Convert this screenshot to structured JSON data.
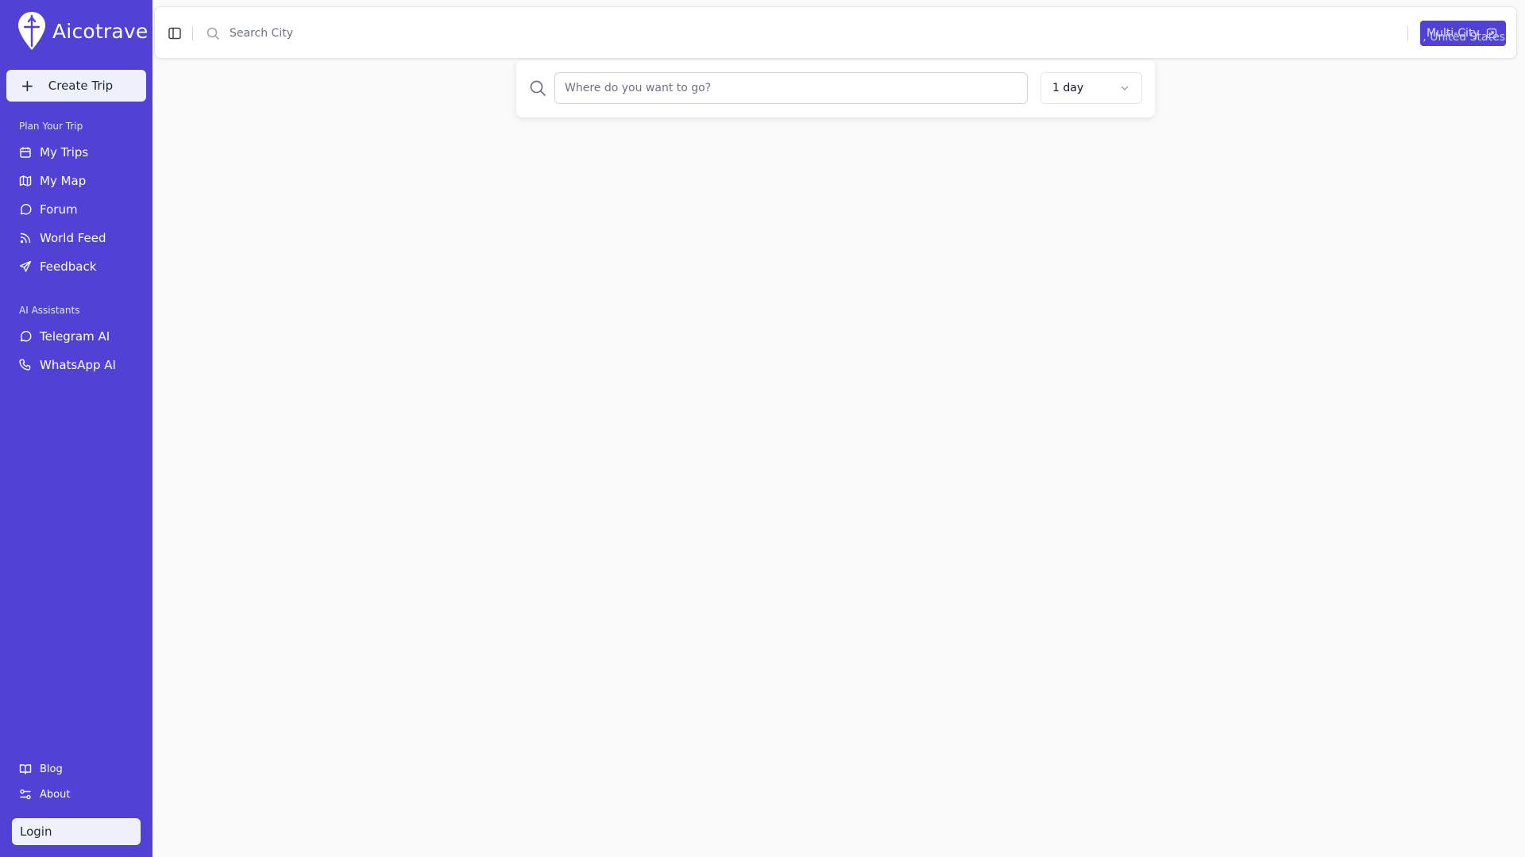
{
  "brand": {
    "name": "Aicotrave"
  },
  "sidebar": {
    "create_trip": "Create Trip",
    "sections": [
      {
        "label": "Plan Your Trip",
        "items": [
          {
            "label": "My Trips",
            "icon": "calendar-icon"
          },
          {
            "label": "My Map",
            "icon": "map-icon"
          },
          {
            "label": "Forum",
            "icon": "message-circle-icon"
          },
          {
            "label": "World Feed",
            "icon": "rss-icon"
          },
          {
            "label": "Feedback",
            "icon": "send-icon"
          }
        ]
      },
      {
        "label": "AI Assistants",
        "items": [
          {
            "label": "Telegram AI",
            "icon": "message-circle-icon"
          },
          {
            "label": "WhatsApp AI",
            "icon": "phone-icon"
          }
        ]
      }
    ],
    "footer_items": [
      {
        "label": "Blog",
        "icon": "book-open-icon"
      },
      {
        "label": "About",
        "icon": "sliders-icon"
      }
    ],
    "login": "Login"
  },
  "topbar": {
    "search_placeholder": "Search City",
    "location_text": ", United States",
    "multi_city_label": "Multi-City"
  },
  "search_panel": {
    "input_placeholder": "Where do you want to go?",
    "duration": "1 day"
  },
  "colors": {
    "sidebar": "#5141d4",
    "accent": "#5141d4",
    "background": "#fafafa"
  }
}
